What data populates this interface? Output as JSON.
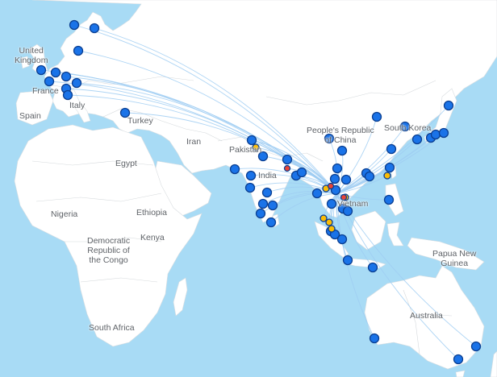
{
  "map": {
    "country_labels": {
      "united_kingdom": "United\nKingdom",
      "france": "France",
      "italy": "Italy",
      "spain": "Spain",
      "turkey": "Turkey",
      "iran": "Iran",
      "pakistan": "Pakistan",
      "india": "India",
      "china": "People's Republic\nof China",
      "south_korea": "South Korea",
      "vietnam": "Vietnam",
      "egypt": "Egypt",
      "nigeria": "Nigeria",
      "ethiopia": "Ethiopia",
      "kenya": "Kenya",
      "drc": "Democratic\nRepublic of\nthe Congo",
      "papua_new_guinea": "Papua New\nGuinea",
      "australia": "Australia",
      "south_africa": "South Africa"
    },
    "marker_colors": {
      "blue": "#1a73e8",
      "yellow": "#fbbc04",
      "red": "#ea4335",
      "route": "#9fcdf2",
      "land": "#ffffff",
      "sea": "#a8dbf5"
    },
    "hub": "Vietnam"
  }
}
